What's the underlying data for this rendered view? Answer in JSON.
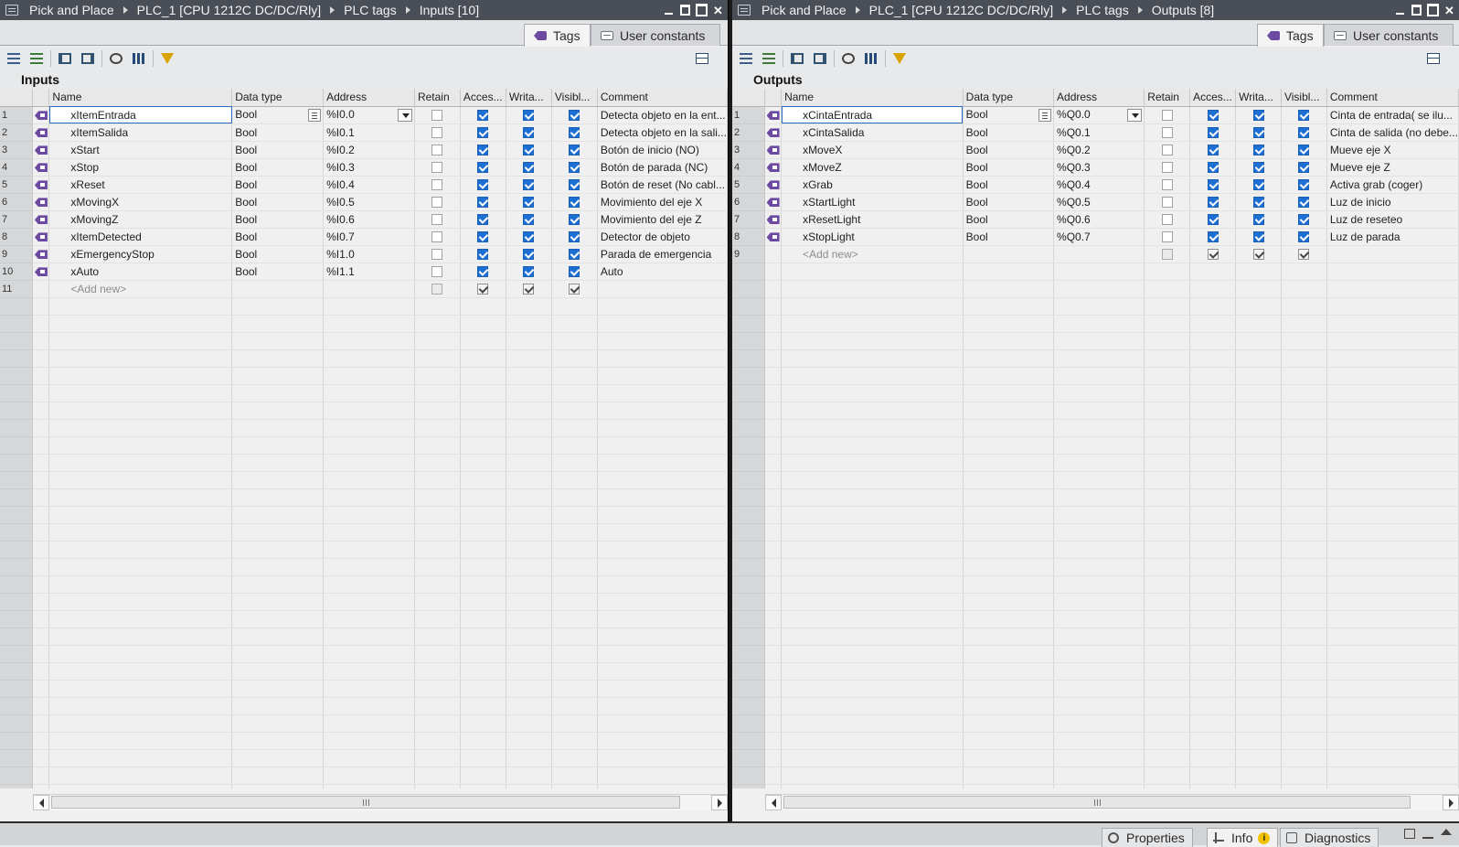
{
  "status_bar": {
    "properties_label": "Properties",
    "info_label": "Info",
    "info_badge": "i",
    "diagnostics_label": "Diagnostics"
  },
  "left": {
    "breadcrumb": [
      "Pick and Place",
      "PLC_1 [CPU 1212C DC/DC/Rly]",
      "PLC tags",
      "Inputs [10]"
    ],
    "tabs": {
      "tags": "Tags",
      "user_constants": "User constants"
    },
    "section_title": "Inputs",
    "columns": [
      "Name",
      "Data type",
      "Address",
      "Retain",
      "Acces...",
      "Writa...",
      "Visibl...",
      "Comment"
    ],
    "rows": [
      {
        "num": "1",
        "name": "xItemEntrada",
        "type": "Bool",
        "address": "%I0.0",
        "comment": "Detecta objeto en la ent..."
      },
      {
        "num": "2",
        "name": "xItemSalida",
        "type": "Bool",
        "address": "%I0.1",
        "comment": "Detecta objeto en la sali..."
      },
      {
        "num": "3",
        "name": "xStart",
        "type": "Bool",
        "address": "%I0.2",
        "comment": "Botón de inicio (NO)"
      },
      {
        "num": "4",
        "name": "xStop",
        "type": "Bool",
        "address": "%I0.3",
        "comment": "Botón de parada (NC)"
      },
      {
        "num": "5",
        "name": "xReset",
        "type": "Bool",
        "address": "%I0.4",
        "comment": "Botón de reset (No cabl..."
      },
      {
        "num": "6",
        "name": "xMovingX",
        "type": "Bool",
        "address": "%I0.5",
        "comment": "Movimiento del eje X"
      },
      {
        "num": "7",
        "name": "xMovingZ",
        "type": "Bool",
        "address": "%I0.6",
        "comment": "Movimiento del eje Z"
      },
      {
        "num": "8",
        "name": "xItemDetected",
        "type": "Bool",
        "address": "%I0.7",
        "comment": "Detector de objeto"
      },
      {
        "num": "9",
        "name": "xEmergencyStop",
        "type": "Bool",
        "address": "%I1.0",
        "comment": "Parada de emergencia"
      },
      {
        "num": "10",
        "name": "xAuto",
        "type": "Bool",
        "address": "%I1.1",
        "comment": "Auto"
      }
    ],
    "add_new": {
      "num": "11",
      "label": "<Add new>"
    }
  },
  "right": {
    "breadcrumb": [
      "Pick and Place",
      "PLC_1 [CPU 1212C DC/DC/Rly]",
      "PLC tags",
      "Outputs [8]"
    ],
    "tabs": {
      "tags": "Tags",
      "user_constants": "User constants"
    },
    "section_title": "Outputs",
    "columns": [
      "Name",
      "Data type",
      "Address",
      "Retain",
      "Acces...",
      "Writa...",
      "Visibl...",
      "Comment"
    ],
    "rows": [
      {
        "num": "1",
        "name": "xCintaEntrada",
        "type": "Bool",
        "address": "%Q0.0",
        "comment": "Cinta de entrada( se ilu..."
      },
      {
        "num": "2",
        "name": "xCintaSalida",
        "type": "Bool",
        "address": "%Q0.1",
        "comment": "Cinta de salida (no debe..."
      },
      {
        "num": "3",
        "name": "xMoveX",
        "type": "Bool",
        "address": "%Q0.2",
        "comment": "Mueve eje X"
      },
      {
        "num": "4",
        "name": "xMoveZ",
        "type": "Bool",
        "address": "%Q0.3",
        "comment": "Mueve eje Z"
      },
      {
        "num": "5",
        "name": "xGrab",
        "type": "Bool",
        "address": "%Q0.4",
        "comment": "Activa grab (coger)"
      },
      {
        "num": "6",
        "name": "xStartLight",
        "type": "Bool",
        "address": "%Q0.5",
        "comment": "Luz de inicio"
      },
      {
        "num": "7",
        "name": "xResetLight",
        "type": "Bool",
        "address": "%Q0.6",
        "comment": "Luz de reseteo"
      },
      {
        "num": "8",
        "name": "xStopLight",
        "type": "Bool",
        "address": "%Q0.7",
        "comment": "Luz de parada"
      }
    ],
    "add_new": {
      "num": "9",
      "label": "<Add new>"
    }
  },
  "colors": {
    "title_bar": "#4a4f57",
    "tag_icon": "#6c4aa1",
    "checkbox_on": "#1e6fd4",
    "filter_icon": "#d6a400",
    "row_header": "#d5d7d9"
  }
}
